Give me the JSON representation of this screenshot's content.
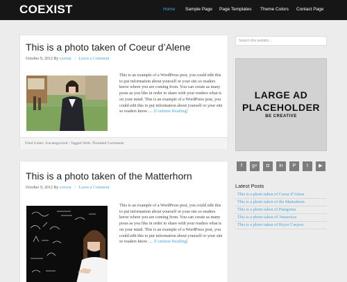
{
  "site": {
    "logo": "COEXIST"
  },
  "nav": {
    "items": [
      {
        "label": "Home",
        "active": true
      },
      {
        "label": "Sample Page"
      },
      {
        "label": "Page Templates"
      },
      {
        "label": "Theme Colors"
      },
      {
        "label": "Contact Page"
      }
    ]
  },
  "posts": [
    {
      "title": "This is a photo taken of Coeur d’Alene",
      "date": "October 9, 2012 By",
      "author": "coexist",
      "comment_link": "Leave a Comment",
      "excerpt": "This is an example of a WordPress post, you could edit this to put information about yourself or your site so readers know where you are coming from. You can create as many posts as you like in order to share with your readers what is on your mind. This is an example of a WordPress post, you could edit this to put information about yourself or your site so readers know …",
      "more": "[Continue Reading]",
      "footer": "Filed Under: Uncategorized  /  Tagged With: Threaded Comments"
    },
    {
      "title": "This is a photo taken of the Matterhorn",
      "date": "October 9, 2012 By",
      "author": "coexist",
      "comment_link": "Leave a Comment",
      "excerpt": "This is an example of a WordPress post, you could edit this to put information about yourself or your site so readers know where you are coming from. You can create as many posts as you like in order to share with your readers what is on your mind. This is an example of a WordPress post, you could edit this to put information about yourself or your site so readers know …",
      "more": "[Continue Reading]"
    }
  ],
  "sidebar": {
    "search_placeholder": "Search this website…",
    "ad": {
      "line1": "LARGE AD",
      "line2": "PLACEHOLDER",
      "line3": "BE CREATIVE"
    },
    "social": [
      {
        "icon": "facebook-icon",
        "glyph": "f"
      },
      {
        "icon": "google-plus-icon",
        "glyph": "g+"
      },
      {
        "icon": "instagram-icon",
        "glyph": "◘"
      },
      {
        "icon": "linkedin-icon",
        "glyph": "in"
      },
      {
        "icon": "pinterest-icon",
        "glyph": "P"
      },
      {
        "icon": "twitter-icon",
        "glyph": "t"
      },
      {
        "icon": "youtube-icon",
        "glyph": "▶"
      }
    ],
    "recent_title": "Latest Posts",
    "recent": [
      "This is a photo taken of Coeur d’Alene",
      "This is a photo taken of the Matterhorn",
      "This is a photo taken of Patagonia",
      "This is a photo taken of Antarctica",
      "This is a photo taken of Bryce Canyon"
    ]
  },
  "colors": {
    "accent": "#4aa3df",
    "header_bg": "#161616",
    "page_bg": "#ececec"
  }
}
